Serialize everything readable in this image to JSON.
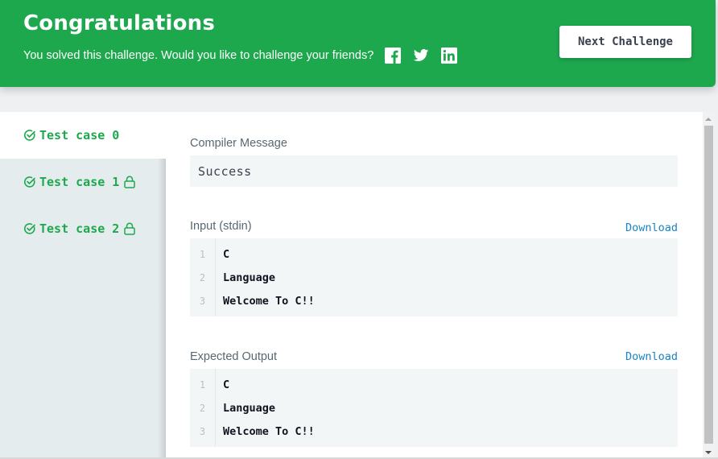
{
  "banner": {
    "title": "Congratulations",
    "subtitle": "You solved this challenge. Would you like to challenge your friends?",
    "social": [
      "facebook-icon",
      "twitter-icon",
      "linkedin-icon"
    ],
    "next_button": "Next Challenge",
    "color": "#1ea84e"
  },
  "tabs": [
    {
      "label": "Test case 0",
      "status": "passed",
      "locked": false,
      "active": true
    },
    {
      "label": "Test case 1",
      "status": "passed",
      "locked": true,
      "active": false
    },
    {
      "label": "Test case 2",
      "status": "passed",
      "locked": true,
      "active": false
    }
  ],
  "compiler": {
    "label": "Compiler Message",
    "message": "Success"
  },
  "input": {
    "label": "Input (stdin)",
    "download": "Download",
    "lines": [
      {
        "num": "1",
        "text": "C"
      },
      {
        "num": "2",
        "text": "Language"
      },
      {
        "num": "3",
        "text": "Welcome To C!!"
      }
    ]
  },
  "expected": {
    "label": "Expected Output",
    "download": "Download",
    "lines": [
      {
        "num": "1",
        "text": "C"
      },
      {
        "num": "2",
        "text": "Language"
      },
      {
        "num": "3",
        "text": "Welcome To C!!"
      }
    ]
  }
}
